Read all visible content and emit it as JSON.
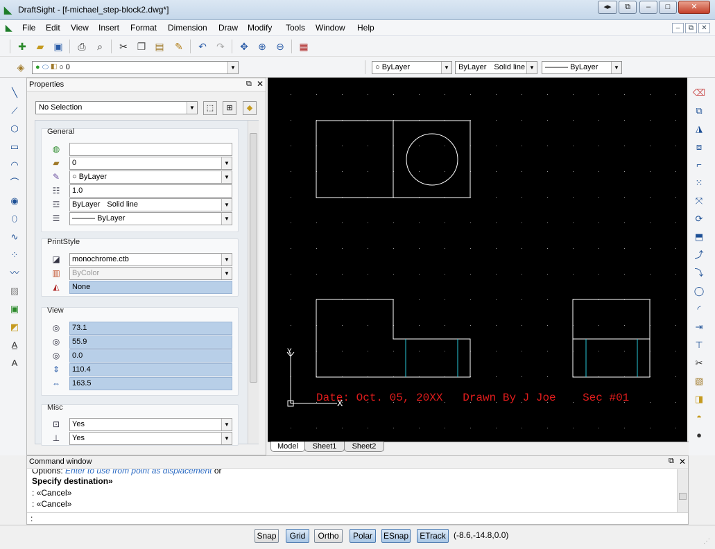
{
  "window": {
    "app_name": "DraftSight",
    "title": "DraftSight - [f-michael_step-block2.dwg*]",
    "btn_min": "‒",
    "btn_max": "□",
    "btn_close": "✕",
    "btn_nav": "◂▸",
    "btn_restore": "⧉"
  },
  "menu": [
    "File",
    "Edit",
    "View",
    "Insert",
    "Format",
    "Dimension",
    "Draw",
    "Modify",
    "Tools",
    "Window",
    "Help"
  ],
  "layer_bar": {
    "layer_value": "0",
    "color_value": "ByLayer",
    "linestyle_value": "ByLayer",
    "linestyle_extra": "Solid line",
    "lineweight_value": "ByLayer"
  },
  "properties": {
    "title": "Properties",
    "selection": "No Selection",
    "general": {
      "title": "General",
      "rows": [
        {
          "value": "",
          "icon": "globe-icon"
        },
        {
          "value": "0",
          "icon": "layer-icon"
        },
        {
          "value": "ByLayer",
          "icon": "color-icon"
        },
        {
          "value": "1.0",
          "icon": "scale-icon"
        },
        {
          "value": "ByLayer",
          "extra": "Solid line",
          "icon": "linestyle-icon"
        },
        {
          "value": "ByLayer",
          "icon": "lineweight-icon"
        }
      ]
    },
    "printstyle": {
      "title": "PrintStyle",
      "rows": [
        {
          "value": "monochrome.ctb"
        },
        {
          "value": "ByColor"
        },
        {
          "value": "None"
        }
      ]
    },
    "view": {
      "title": "View",
      "rows": [
        "73.1",
        "55.9",
        "0.0",
        "110.4",
        "163.5"
      ]
    },
    "misc": {
      "title": "Misc",
      "rows": [
        "Yes",
        "Yes"
      ]
    }
  },
  "drawing": {
    "annotation": "Date: Oct. 05, 20XX   Drawn By J Joe    Sec #01",
    "axis_x": "X",
    "axis_y": "Y"
  },
  "tabs": [
    "Model",
    "Sheet1",
    "Sheet2"
  ],
  "command": {
    "title": "Command window",
    "line1_prefix": "Options: ",
    "line1_hint": "Enter to use from point as displacement",
    "line1_suffix": " or",
    "line2": "Specify destination»",
    "line3": ": «Cancel»",
    "line4": ": «Cancel»",
    "prompt": ":"
  },
  "status": {
    "buttons": [
      {
        "label": "Snap",
        "on": false
      },
      {
        "label": "Grid",
        "on": true
      },
      {
        "label": "Ortho",
        "on": false
      },
      {
        "label": "Polar",
        "on": true
      },
      {
        "label": "ESnap",
        "on": true
      },
      {
        "label": "ETrack",
        "on": true
      }
    ],
    "coords": "(-8.6,-14.8,0.0)"
  }
}
